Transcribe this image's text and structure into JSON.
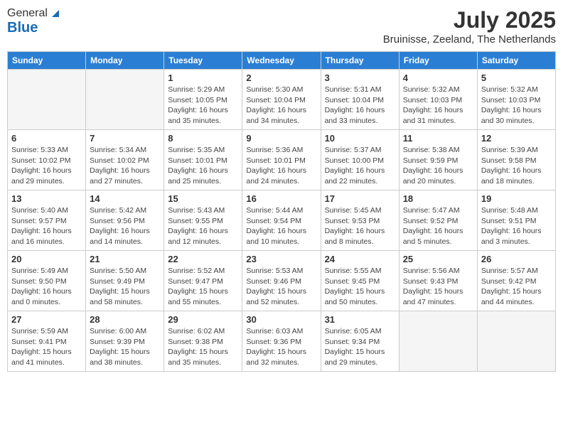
{
  "logo": {
    "line1": "General",
    "line2": "Blue"
  },
  "title": "July 2025",
  "location": "Bruinisse, Zeeland, The Netherlands",
  "weekdays": [
    "Sunday",
    "Monday",
    "Tuesday",
    "Wednesday",
    "Thursday",
    "Friday",
    "Saturday"
  ],
  "weeks": [
    [
      {
        "day": "",
        "info": ""
      },
      {
        "day": "",
        "info": ""
      },
      {
        "day": "1",
        "info": "Sunrise: 5:29 AM\nSunset: 10:05 PM\nDaylight: 16 hours\nand 35 minutes."
      },
      {
        "day": "2",
        "info": "Sunrise: 5:30 AM\nSunset: 10:04 PM\nDaylight: 16 hours\nand 34 minutes."
      },
      {
        "day": "3",
        "info": "Sunrise: 5:31 AM\nSunset: 10:04 PM\nDaylight: 16 hours\nand 33 minutes."
      },
      {
        "day": "4",
        "info": "Sunrise: 5:32 AM\nSunset: 10:03 PM\nDaylight: 16 hours\nand 31 minutes."
      },
      {
        "day": "5",
        "info": "Sunrise: 5:32 AM\nSunset: 10:03 PM\nDaylight: 16 hours\nand 30 minutes."
      }
    ],
    [
      {
        "day": "6",
        "info": "Sunrise: 5:33 AM\nSunset: 10:02 PM\nDaylight: 16 hours\nand 29 minutes."
      },
      {
        "day": "7",
        "info": "Sunrise: 5:34 AM\nSunset: 10:02 PM\nDaylight: 16 hours\nand 27 minutes."
      },
      {
        "day": "8",
        "info": "Sunrise: 5:35 AM\nSunset: 10:01 PM\nDaylight: 16 hours\nand 25 minutes."
      },
      {
        "day": "9",
        "info": "Sunrise: 5:36 AM\nSunset: 10:01 PM\nDaylight: 16 hours\nand 24 minutes."
      },
      {
        "day": "10",
        "info": "Sunrise: 5:37 AM\nSunset: 10:00 PM\nDaylight: 16 hours\nand 22 minutes."
      },
      {
        "day": "11",
        "info": "Sunrise: 5:38 AM\nSunset: 9:59 PM\nDaylight: 16 hours\nand 20 minutes."
      },
      {
        "day": "12",
        "info": "Sunrise: 5:39 AM\nSunset: 9:58 PM\nDaylight: 16 hours\nand 18 minutes."
      }
    ],
    [
      {
        "day": "13",
        "info": "Sunrise: 5:40 AM\nSunset: 9:57 PM\nDaylight: 16 hours\nand 16 minutes."
      },
      {
        "day": "14",
        "info": "Sunrise: 5:42 AM\nSunset: 9:56 PM\nDaylight: 16 hours\nand 14 minutes."
      },
      {
        "day": "15",
        "info": "Sunrise: 5:43 AM\nSunset: 9:55 PM\nDaylight: 16 hours\nand 12 minutes."
      },
      {
        "day": "16",
        "info": "Sunrise: 5:44 AM\nSunset: 9:54 PM\nDaylight: 16 hours\nand 10 minutes."
      },
      {
        "day": "17",
        "info": "Sunrise: 5:45 AM\nSunset: 9:53 PM\nDaylight: 16 hours\nand 8 minutes."
      },
      {
        "day": "18",
        "info": "Sunrise: 5:47 AM\nSunset: 9:52 PM\nDaylight: 16 hours\nand 5 minutes."
      },
      {
        "day": "19",
        "info": "Sunrise: 5:48 AM\nSunset: 9:51 PM\nDaylight: 16 hours\nand 3 minutes."
      }
    ],
    [
      {
        "day": "20",
        "info": "Sunrise: 5:49 AM\nSunset: 9:50 PM\nDaylight: 16 hours\nand 0 minutes."
      },
      {
        "day": "21",
        "info": "Sunrise: 5:50 AM\nSunset: 9:49 PM\nDaylight: 15 hours\nand 58 minutes."
      },
      {
        "day": "22",
        "info": "Sunrise: 5:52 AM\nSunset: 9:47 PM\nDaylight: 15 hours\nand 55 minutes."
      },
      {
        "day": "23",
        "info": "Sunrise: 5:53 AM\nSunset: 9:46 PM\nDaylight: 15 hours\nand 52 minutes."
      },
      {
        "day": "24",
        "info": "Sunrise: 5:55 AM\nSunset: 9:45 PM\nDaylight: 15 hours\nand 50 minutes."
      },
      {
        "day": "25",
        "info": "Sunrise: 5:56 AM\nSunset: 9:43 PM\nDaylight: 15 hours\nand 47 minutes."
      },
      {
        "day": "26",
        "info": "Sunrise: 5:57 AM\nSunset: 9:42 PM\nDaylight: 15 hours\nand 44 minutes."
      }
    ],
    [
      {
        "day": "27",
        "info": "Sunrise: 5:59 AM\nSunset: 9:41 PM\nDaylight: 15 hours\nand 41 minutes."
      },
      {
        "day": "28",
        "info": "Sunrise: 6:00 AM\nSunset: 9:39 PM\nDaylight: 15 hours\nand 38 minutes."
      },
      {
        "day": "29",
        "info": "Sunrise: 6:02 AM\nSunset: 9:38 PM\nDaylight: 15 hours\nand 35 minutes."
      },
      {
        "day": "30",
        "info": "Sunrise: 6:03 AM\nSunset: 9:36 PM\nDaylight: 15 hours\nand 32 minutes."
      },
      {
        "day": "31",
        "info": "Sunrise: 6:05 AM\nSunset: 9:34 PM\nDaylight: 15 hours\nand 29 minutes."
      },
      {
        "day": "",
        "info": ""
      },
      {
        "day": "",
        "info": ""
      }
    ]
  ]
}
